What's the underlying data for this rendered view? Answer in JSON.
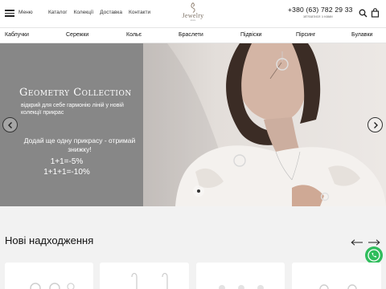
{
  "header": {
    "menu_label": "Меню",
    "nav": [
      "Каталог",
      "Колекції",
      "Доставка",
      "Контакти"
    ],
    "logo_text": "Jewelry",
    "logo_sub": "store",
    "phone": "+380 (63) 782 29 33",
    "callback": "зв'язатися з нами"
  },
  "categories": [
    "Каблучки",
    "Сережки",
    "Кольє",
    "Браслети",
    "Підвіски",
    "Пірсинг",
    "Булавки"
  ],
  "hero": {
    "title": "Geometry Collection",
    "subtitle": "відкрий для себе гармонію ліній у новій колекції прикрас",
    "promo": "Додай ще одну прикрасу - отримай знижку!",
    "offer_1": "1+1=-5%",
    "offer_2": "1+1+1=-10%"
  },
  "new_arrivals": {
    "title": "Нові надходження"
  },
  "colors": {
    "hero_bg": "#878787",
    "viber": "#2fbd5c"
  }
}
